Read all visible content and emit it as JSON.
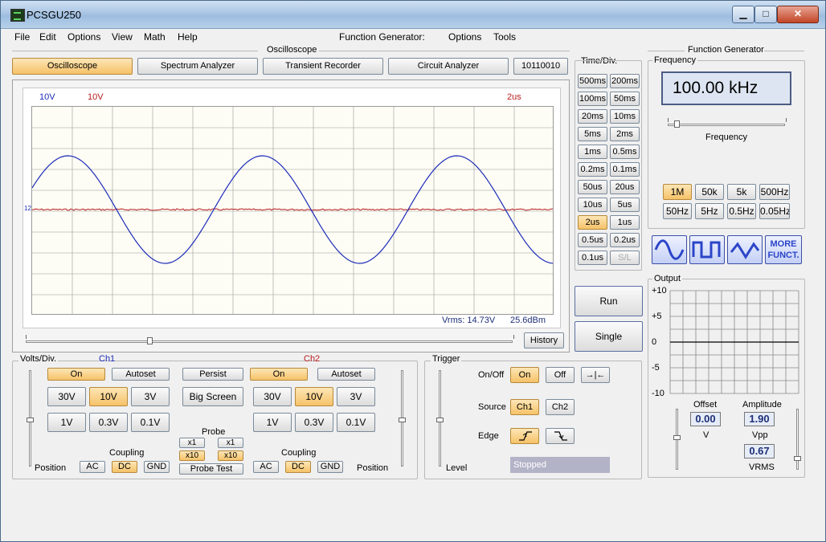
{
  "window": {
    "title": "PCSGU250",
    "minimize": "▁",
    "maximize": "□",
    "close": "✕"
  },
  "menus": {
    "left": [
      "File",
      "Edit",
      "Options",
      "View",
      "Math",
      "Help"
    ],
    "fg_title": "Function Generator:",
    "right": [
      "Options",
      "Tools"
    ]
  },
  "oscilloscope": {
    "section_title": "Oscilloscope",
    "tabs": [
      "Oscilloscope",
      "Spectrum Analyzer",
      "Transient Recorder",
      "Circuit Analyzer",
      "10110010"
    ],
    "active_tab": 0,
    "ch1_scale": "10V",
    "ch2_scale": "10V",
    "time_scale": "2us",
    "marker": "12",
    "vrms": "Vrms: 14.73V",
    "dbm": "25.6dBm",
    "history": "History",
    "colors": {
      "ch1": "#1c2bb8",
      "ch2": "#b81c1c",
      "grid": "#9a9a9a"
    }
  },
  "timediv": {
    "title": "Time/Div.",
    "buttons": [
      "500ms",
      "200ms",
      "100ms",
      "50ms",
      "20ms",
      "10ms",
      "5ms",
      "2ms",
      "1ms",
      "0.5ms",
      "0.2ms",
      "0.1ms",
      "50us",
      "20us",
      "10us",
      "5us",
      "2us",
      "1us",
      "0.5us",
      "0.2us",
      "0.1us",
      "S/L"
    ],
    "selected": "2us",
    "disabled": "S/L"
  },
  "run": "Run",
  "single": "Single",
  "volts": {
    "title": "Volts/Div.",
    "ch1": "Ch1",
    "ch2": "Ch2",
    "on": "On",
    "autoset": "Autoset",
    "persist": "Persist",
    "big_screen": "Big Screen",
    "range_row1": [
      "30V",
      "10V",
      "3V"
    ],
    "range_row2": [
      "1V",
      "0.3V",
      "0.1V"
    ],
    "selected": "10V",
    "probe": "Probe",
    "x1": "x1",
    "x10": "x10",
    "probe_test": "Probe Test",
    "coupling": "Coupling",
    "coupling_opts": [
      "AC",
      "DC",
      "GND"
    ],
    "coupling_selected": "DC",
    "position": "Position"
  },
  "trigger": {
    "title": "Trigger",
    "onoff": "On/Off",
    "on": "On",
    "off": "Off",
    "center_sym": "→|←",
    "source": "Source",
    "ch1": "Ch1",
    "ch2": "Ch2",
    "edge": "Edge",
    "level": "Level",
    "status": "Stopped"
  },
  "funcgen": {
    "title": "Function Generator",
    "frequency_label": "Frequency",
    "frequency_value": "100.00 kHz",
    "slider_label": "Frequency",
    "range_row1": [
      "1M",
      "50k",
      "5k",
      "500Hz"
    ],
    "range_row2": [
      "50Hz",
      "5Hz",
      "0.5Hz",
      "0.05Hz"
    ],
    "range_selected": "1M",
    "more": "MORE\nFUNCT.",
    "more_l1": "MORE",
    "more_l2": "FUNCT.",
    "output_label": "Output",
    "output_ticks": [
      "+10",
      "+5",
      "0",
      "-5",
      "-10"
    ],
    "offset_label": "Offset",
    "offset_value": "0.00",
    "offset_unit": "V",
    "amplitude_label": "Amplitude",
    "amplitude_value": "1.90",
    "amplitude_unit": "Vpp",
    "vrms_value": "0.67",
    "vrms_unit": "VRMS"
  }
}
